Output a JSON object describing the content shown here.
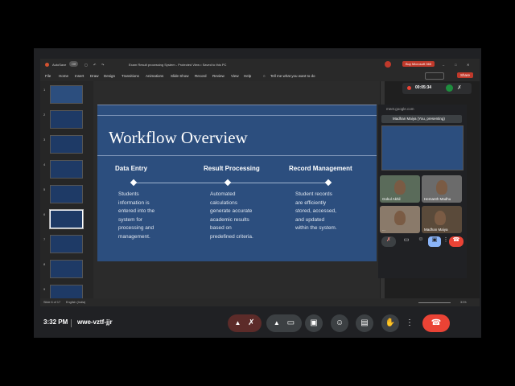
{
  "ppt": {
    "autosave_label": "AutoSave",
    "autosave_state": "Off",
    "window_title": "Exam Result processing System  -  Protected View  •  Saved to this PC",
    "account_label": "Buy Microsoft 365",
    "share_label": "Share",
    "menu": [
      "File",
      "Home",
      "Insert",
      "Draw",
      "Design",
      "Transitions",
      "Animations",
      "Slide Show",
      "Record",
      "Review",
      "View",
      "Help"
    ],
    "search_placeholder": "Tell me what you want to do",
    "slide_numbers": [
      "1",
      "2",
      "3",
      "4",
      "5",
      "6",
      "7",
      "8",
      "9"
    ],
    "status_left": "Slide 6 of 17",
    "status_lang": "English (India)",
    "zoom": "31%"
  },
  "slide": {
    "title": "Workflow Overview",
    "columns": [
      {
        "heading": "Data Entry",
        "desc": "Students\ninformation is\nentered into the\nsystem for\nprocessing and\nmanagement."
      },
      {
        "heading": "Result Processing",
        "desc": "Automated\ncalculations\ngenerate accurate\nacademic results\nbased on\npredefined criteria."
      },
      {
        "heading": "Record Management",
        "desc": "Student records\nare efficiently\nstored, accessed,\nand updated\nwithin the system."
      }
    ]
  },
  "meet_panel": {
    "timer": "00:05:34",
    "url": "meet.google.com",
    "presenter": "Madhan Maiya (You, presenting)",
    "participants": [
      "Gokul Akhil",
      "Hemanth Madhu",
      "...",
      "Madhan Maiya"
    ]
  },
  "bottom": {
    "clock": "3:32 PM",
    "meeting_code": "wwe-vztf-jjr"
  },
  "colors": {
    "slide_bg": "#2c4e7e",
    "end_call": "#ea4335",
    "raise_accent": "#8ab4f8"
  }
}
